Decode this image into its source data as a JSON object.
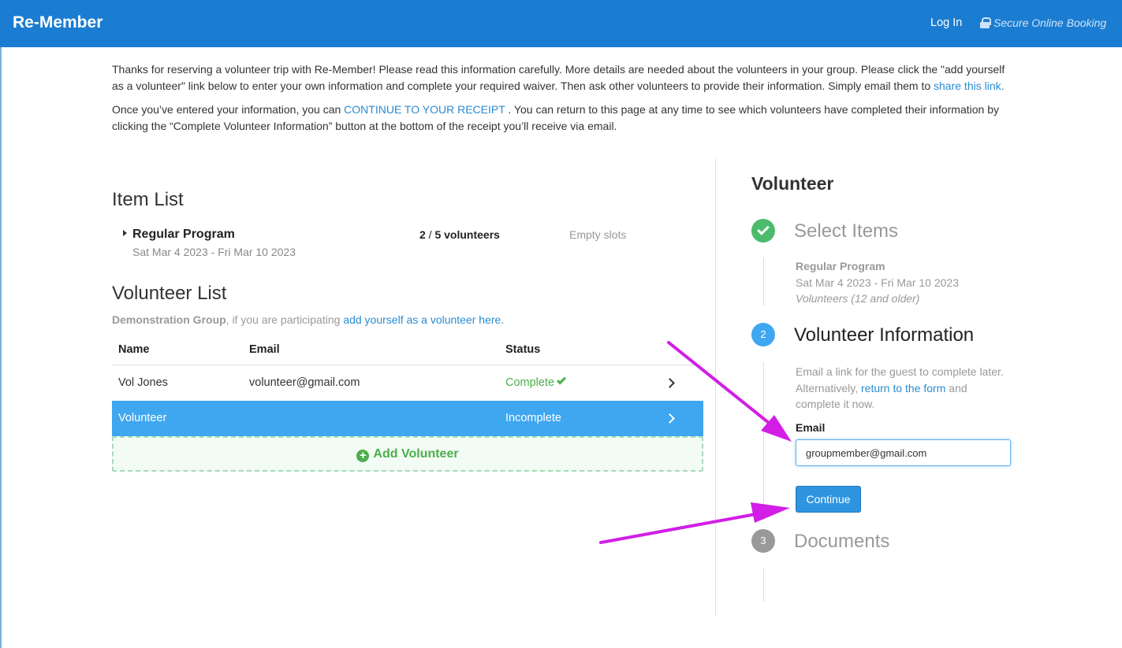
{
  "header": {
    "brand": "Re-Member",
    "login_label": "Log In",
    "secure_label": "Secure Online Booking",
    "bg_color": "#1b7dd1"
  },
  "intro": {
    "p1_text": "Thanks for reserving a volunteer trip with Re-Member! Please read this information carefully. More details are needed about the volunteers in your group. Please click the \"add yourself as a volunteer\" link below to enter your own information and complete your required waiver. Then ask other volunteers to provide their information. Simply email them to ",
    "p1_link": "share this link.",
    "p2_before": "Once you’ve entered your information, you can ",
    "p2_link": "CONTINUE TO YOUR RECEIPT",
    "p2_after": " . You can return to this page at any time to see which volunteers have completed their information by clicking the “Complete Volunteer Information” button at the bottom of the receipt you’ll receive via email."
  },
  "item_list": {
    "title": "Item List",
    "item": {
      "name": "Regular Program",
      "dates": "Sat Mar 4 2023 - Fri Mar 10 2023",
      "count_filled": "2",
      "count_sep": " / ",
      "count_total": "5 volunteers",
      "empty_label": "Empty slots"
    }
  },
  "volunteer_list": {
    "title": "Volunteer List",
    "group_name": "Demonstration Group",
    "group_text": ", if you are participating ",
    "group_link": "add yourself as a volunteer here.",
    "columns": [
      "Name",
      "Email",
      "Status"
    ],
    "rows": [
      {
        "name": "Vol Jones",
        "email": "volunteer@gmail.com",
        "status": "Complete",
        "selected": false
      },
      {
        "name": "Volunteer",
        "email": "",
        "status": "Incomplete",
        "selected": true
      }
    ],
    "add_label": "Add Volunteer"
  },
  "sidebar": {
    "title": "Volunteer",
    "steps": [
      {
        "number": "",
        "label": "Select Items",
        "state": "done"
      },
      {
        "number": "2",
        "label": "Volunteer Information",
        "state": "active"
      },
      {
        "number": "3",
        "label": "Documents",
        "state": "pending"
      }
    ],
    "selected_item": {
      "name": "Regular Program",
      "dates": "Sat Mar 4 2023 - Fri Mar 10 2023",
      "type": "Volunteers (12 and older)"
    },
    "info_before": "Email a link for the guest to complete later. Alternatively, ",
    "info_link": "return to the form",
    "info_after": " and complete it now.",
    "email_label": "Email",
    "email_value": "groupmember@gmail.com",
    "continue_label": "Continue"
  },
  "colors": {
    "link": "#2a8bd0",
    "success": "#4cae4c",
    "selected_row": "#3fa7f0",
    "annotation_arrow": "#d21ee6"
  }
}
